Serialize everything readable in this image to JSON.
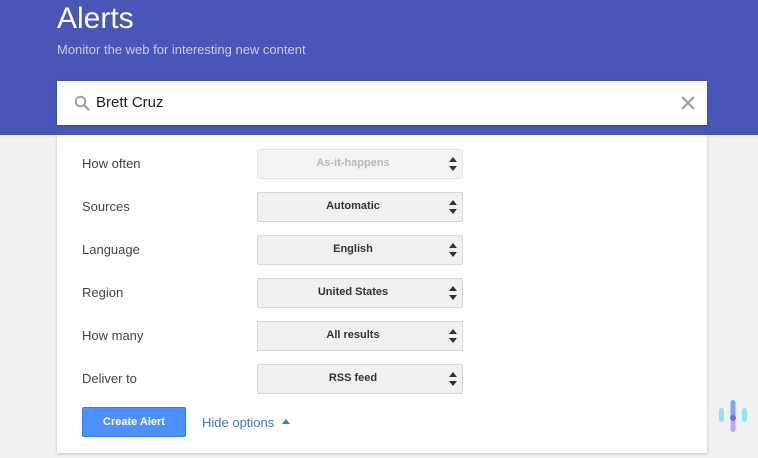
{
  "header": {
    "title": "Alerts",
    "subtitle": "Monitor the web for interesting new content",
    "background_color": "#4a55b8"
  },
  "search": {
    "value": "Brett Cruz",
    "search_icon": "search-icon",
    "clear_icon": "close-icon"
  },
  "options": [
    {
      "label": "How often",
      "value": "As-it-happens",
      "disabled": true
    },
    {
      "label": "Sources",
      "value": "Automatic",
      "disabled": false
    },
    {
      "label": "Language",
      "value": "English",
      "disabled": false
    },
    {
      "label": "Region",
      "value": "United States",
      "disabled": false
    },
    {
      "label": "How many",
      "value": "All results",
      "disabled": false
    },
    {
      "label": "Deliver to",
      "value": "RSS feed",
      "disabled": false
    }
  ],
  "actions": {
    "create_label": "Create Alert",
    "hide_options_label": "Hide options",
    "accent_color": "#4d90fe",
    "link_color": "#4474c4"
  }
}
